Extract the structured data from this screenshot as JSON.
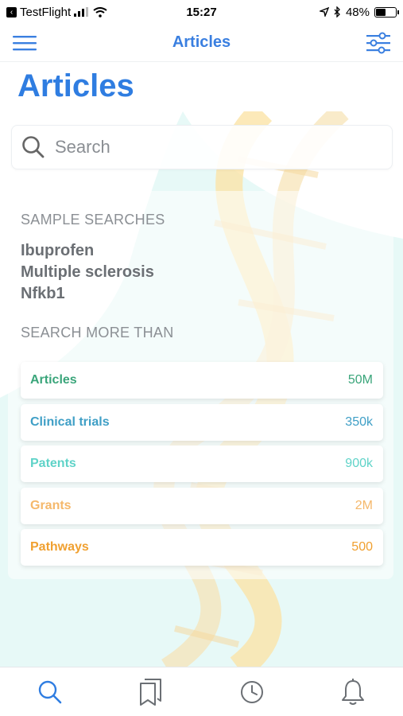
{
  "status_bar": {
    "back_app": "TestFlight",
    "time": "15:27",
    "battery": "48%",
    "battery_level": 0.48
  },
  "nav": {
    "title": "Articles",
    "menu_icon": "hamburger-menu-icon",
    "filter_icon": "sliders-icon"
  },
  "page_title": "Articles",
  "search": {
    "placeholder": "Search",
    "value": ""
  },
  "sample_searches": {
    "heading": "SAMPLE SEARCHES",
    "items": [
      "Ibuprofen",
      "Multiple sclerosis",
      "Nfkb1"
    ]
  },
  "search_more": {
    "heading": "SEARCH MORE THAN",
    "items": [
      {
        "label": "Articles",
        "count": "50M",
        "color": "#3aa57a"
      },
      {
        "label": "Clinical trials",
        "count": "350k",
        "color": "#3f9fc6"
      },
      {
        "label": "Patents",
        "count": "900k",
        "color": "#5fd3c8"
      },
      {
        "label": "Grants",
        "count": "2M",
        "color": "#f5b86b"
      },
      {
        "label": "Pathways",
        "count": "500",
        "color": "#f0a030"
      }
    ]
  },
  "tab_bar": {
    "tabs": [
      {
        "name": "search-icon",
        "active": true
      },
      {
        "name": "bookmarks-icon",
        "active": false
      },
      {
        "name": "history-clock-icon",
        "active": false
      },
      {
        "name": "bell-icon",
        "active": false
      }
    ]
  },
  "colors": {
    "accent": "#2f7de1",
    "tab_active": "#2f7de1",
    "tab_inactive": "#6b6f74"
  }
}
